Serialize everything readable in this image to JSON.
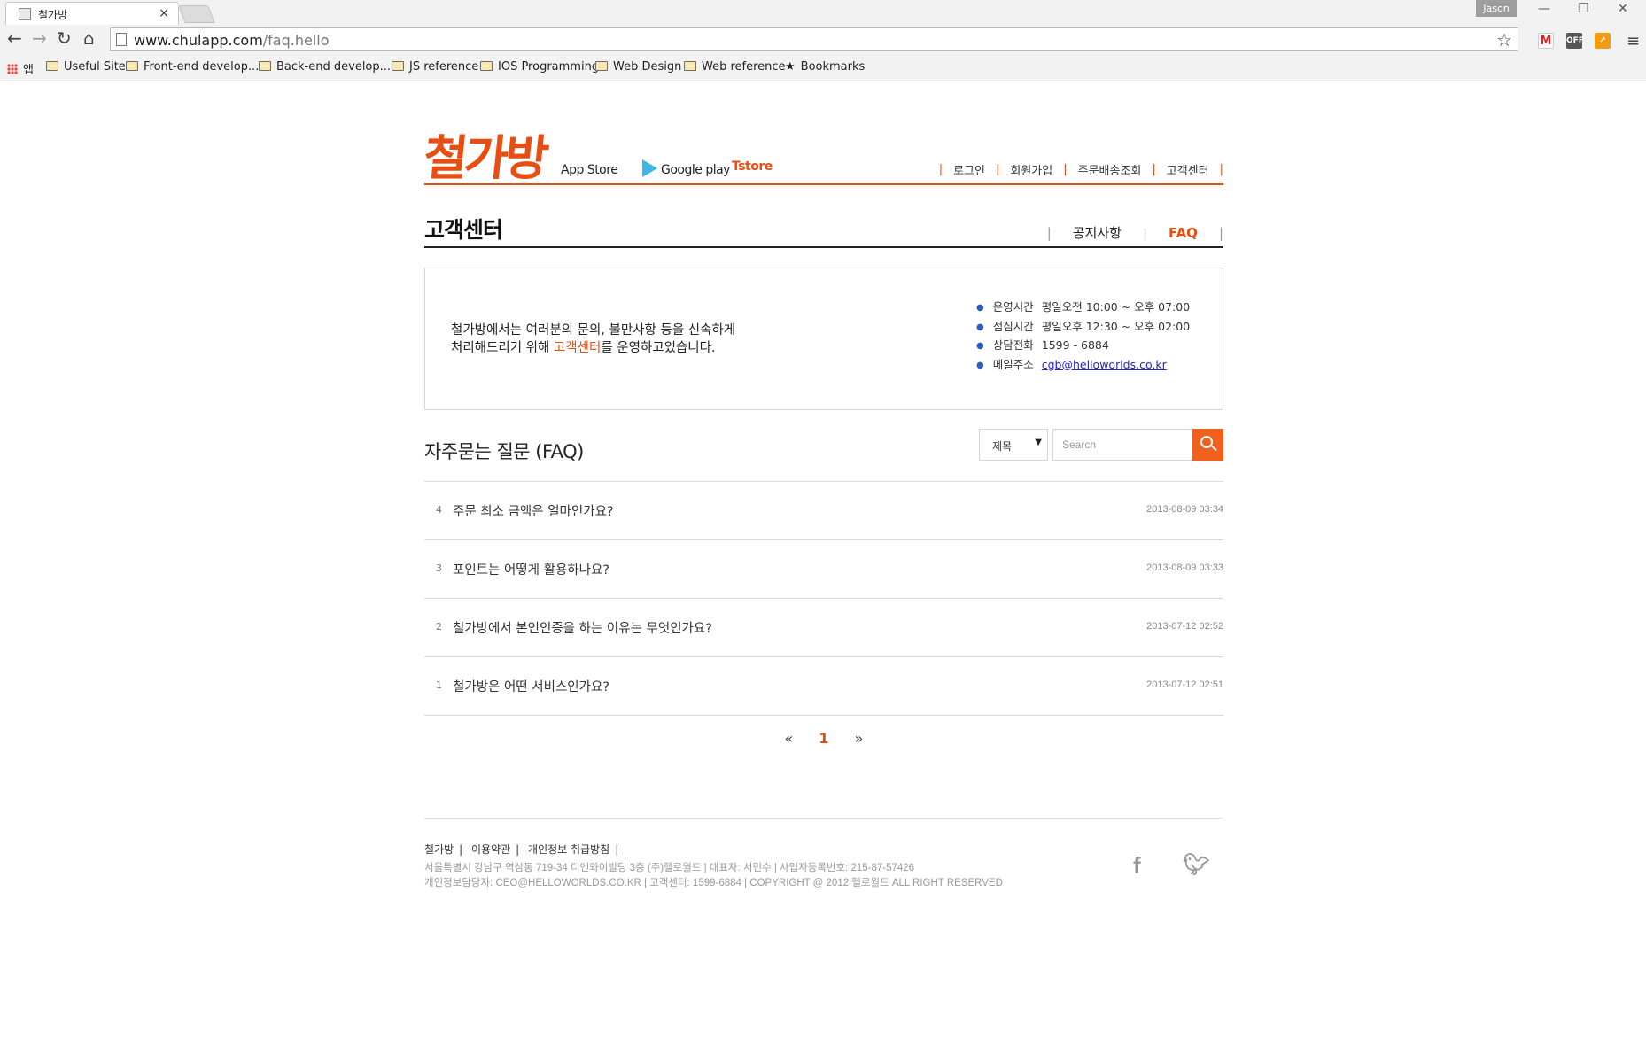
{
  "browser": {
    "tab_title": "철가방",
    "tab_close": "×",
    "profile": "Jason",
    "url_host": "www.chulapp.com",
    "url_path": "/faq.hello",
    "bookmarks": [
      {
        "label": "앱",
        "kind": "apps"
      },
      {
        "label": "Useful Site",
        "kind": "folder"
      },
      {
        "label": "Front-end develop...",
        "kind": "folder"
      },
      {
        "label": "Back-end develop...",
        "kind": "folder"
      },
      {
        "label": "JS reference",
        "kind": "folder"
      },
      {
        "label": "IOS Programming",
        "kind": "folder"
      },
      {
        "label": "Web Design",
        "kind": "folder"
      },
      {
        "label": "Web reference",
        "kind": "folder"
      },
      {
        "label": "Bookmarks",
        "kind": "star"
      }
    ],
    "ext_off": "OFF"
  },
  "site": {
    "logo": "철가방",
    "stores": {
      "appstore": "App Store",
      "googleplay": "Google play",
      "tstore": "store"
    },
    "topnav": [
      "로그인",
      "회원가입",
      "주문배송조회",
      "고객센터"
    ]
  },
  "header": {
    "title": "고객센터",
    "subnav": [
      "공지사항",
      "FAQ"
    ],
    "active_subnav": "FAQ"
  },
  "info": {
    "line1": "철가방에서는 여러분의 문의, 불만사항 등을 신속하게",
    "line2_pre": "처리해드리기 위해 ",
    "line2_hl": "고객센터",
    "line2_post": "를 운영하고있습니다.",
    "items": [
      {
        "key": "운영시간",
        "value": "평일오전 10:00 ~ 오후 07:00"
      },
      {
        "key": "점심시간",
        "value": "평일오후 12:30 ~ 오후 02:00"
      },
      {
        "key": "상담전화",
        "value": "1599 - 6884"
      },
      {
        "key": "메일주소",
        "value": "cgb@helloworlds.co.kr"
      }
    ]
  },
  "faq": {
    "title": "자주묻는 질문 (FAQ)",
    "select_value": "제목",
    "search_placeholder": "Search",
    "rows": [
      {
        "num": "4",
        "question": "주문 최소 금액은 얼마인가요?",
        "date": "2013-08-09 03:34"
      },
      {
        "num": "3",
        "question": "포인트는 어떻게 활용하나요?",
        "date": "2013-08-09 03:33"
      },
      {
        "num": "2",
        "question": "철가방에서 본인인증을 하는 이유는 무엇인가요?",
        "date": "2013-07-12 02:52"
      },
      {
        "num": "1",
        "question": "철가방은 어떤 서비스인가요?",
        "date": "2013-07-12 02:51"
      }
    ]
  },
  "pager": {
    "prev": "«",
    "current": "1",
    "next": "»"
  },
  "footer": {
    "links": [
      "철가방",
      "이용약관",
      "개인정보 취급방침"
    ],
    "address": "서울특별시 강남구 역삼동 719-34 디엔와이빌딩 3층 (주)헬로월드 | 대표자: 서민수 | 사업자등록번호: 215-87-57426",
    "privacy": "개인정보담당자: CEO@HELLOWORLDS.CO.KR | 고객센터: 1599-6884 | COPYRIGHT @ 2012 헬로월드 ALL RIGHT RESERVED"
  },
  "colors": {
    "accent": "#e84d12",
    "search_button": "#f0601f",
    "link": "#2326c9"
  }
}
